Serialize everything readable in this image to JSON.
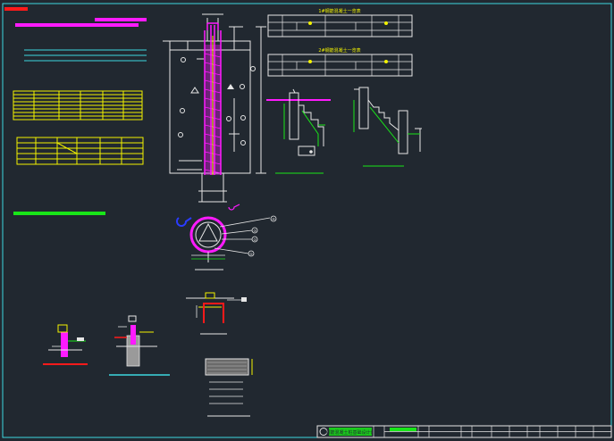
{
  "colors": {
    "background": "#212830",
    "frame": "#3dd8e0",
    "white": "#e6e6e6",
    "magenta": "#ff1aff",
    "yellow": "#f2f200",
    "green": "#19e619",
    "red": "#ff1a1a",
    "cyan": "#3dd8e0",
    "blue": "#2a3cff"
  },
  "elevations": {
    "top_label": "1#钢筋混凝土一览表",
    "bottom_label": "2#钢筋混凝土一览表"
  },
  "section": {
    "callout_1": "①",
    "callout_2": "②",
    "callout_3": "③",
    "callout_4": "④"
  },
  "title_block": {
    "project_name": "某钢筋混凝土桩基础设计详图"
  }
}
